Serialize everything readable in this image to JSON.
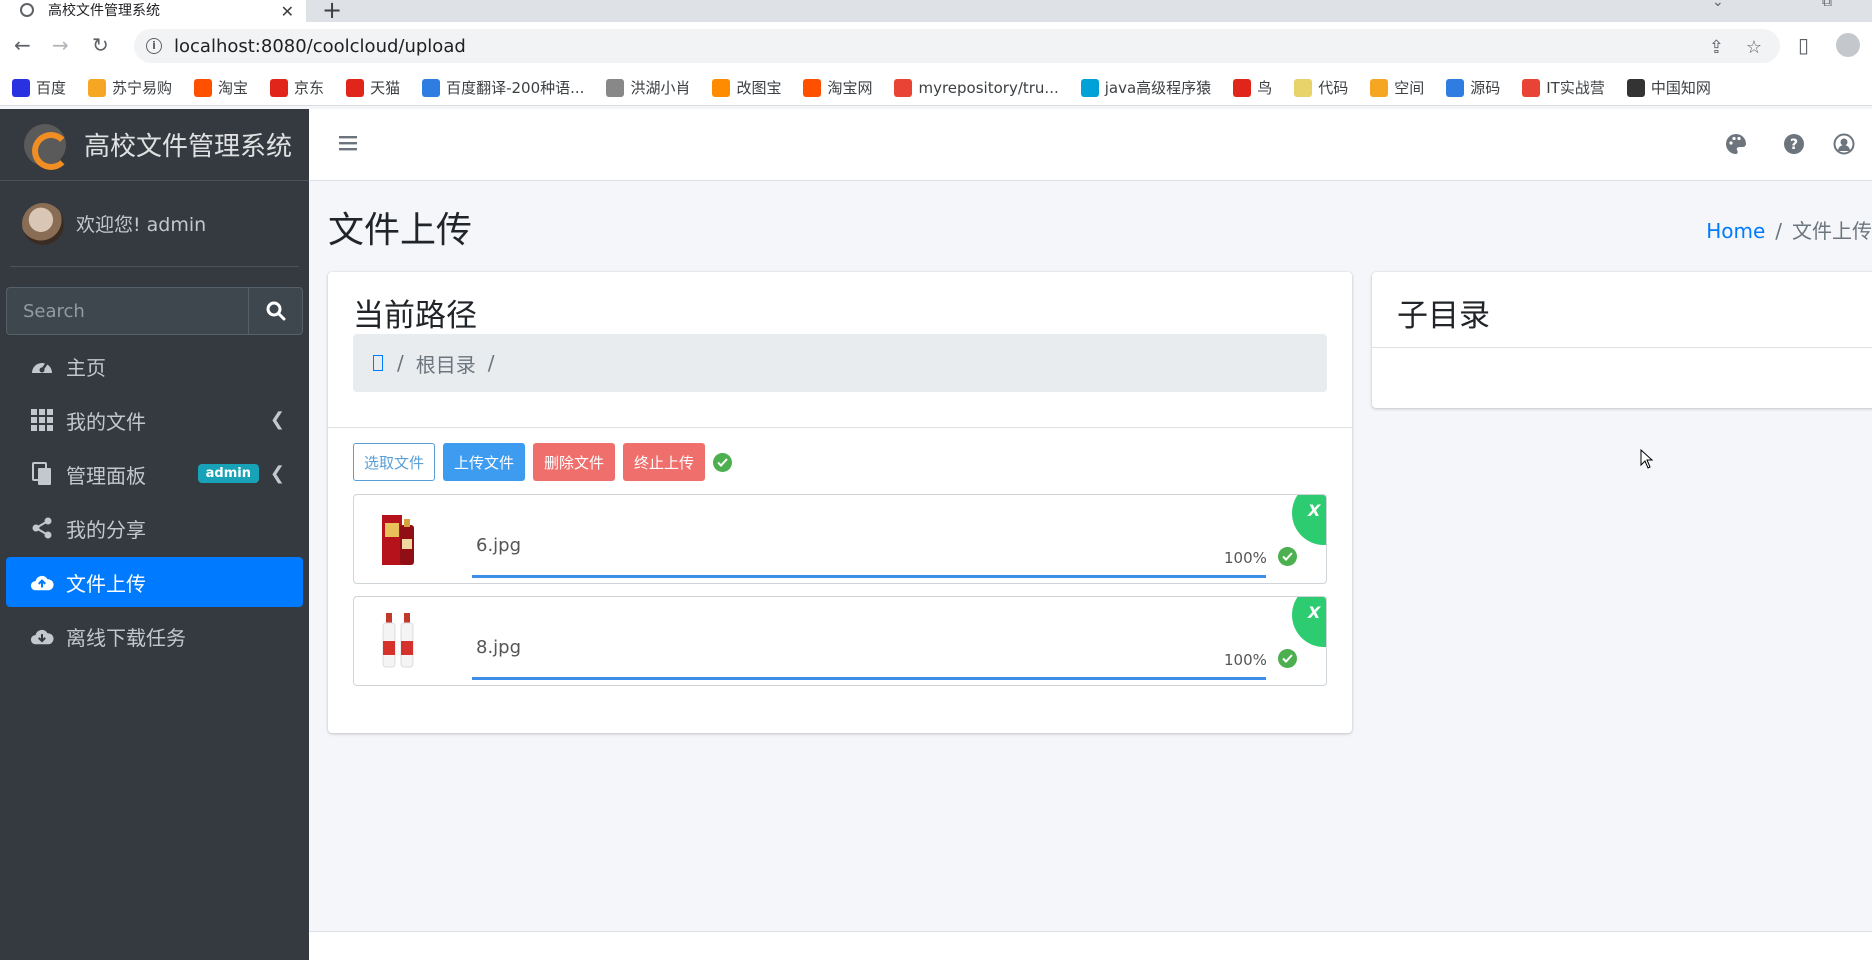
{
  "browser": {
    "tab_title": "高校文件管理系统",
    "url": "localhost:8080/coolcloud/upload",
    "bookmarks": [
      {
        "label": "百度",
        "color": "#2932e1"
      },
      {
        "label": "苏宁易购",
        "color": "#f5a623"
      },
      {
        "label": "淘宝",
        "color": "#ff5000"
      },
      {
        "label": "京东",
        "color": "#e1251b"
      },
      {
        "label": "天猫",
        "color": "#e1251b"
      },
      {
        "label": "百度翻译-200种语...",
        "color": "#2f7de1"
      },
      {
        "label": "洪湖小肖",
        "color": "#888888"
      },
      {
        "label": "改图宝",
        "color": "#ff8c00"
      },
      {
        "label": "淘宝网",
        "color": "#ff5000"
      },
      {
        "label": "myrepository/tru...",
        "color": "#e84335"
      },
      {
        "label": "java高级程序猿",
        "color": "#00a1d6"
      },
      {
        "label": "鸟",
        "color": "#e1251b"
      },
      {
        "label": "代码",
        "color": "#e8d36b"
      },
      {
        "label": "空间",
        "color": "#f5a623"
      },
      {
        "label": "源码",
        "color": "#2f7de1"
      },
      {
        "label": "IT实战营",
        "color": "#e84335"
      },
      {
        "label": "中国知网",
        "color": "#333333"
      }
    ]
  },
  "sidebar": {
    "brand": "高校文件管理系统",
    "user": "欢迎您! admin",
    "search_placeholder": "Search",
    "items": [
      {
        "label": "主页",
        "icon": "dashboard-icon"
      },
      {
        "label": "我的文件",
        "icon": "grid-icon"
      },
      {
        "label": "管理面板",
        "icon": "copy-icon",
        "badge": "admin"
      },
      {
        "label": "我的分享",
        "icon": "share-icon"
      },
      {
        "label": "文件上传",
        "icon": "cloud-upload-icon"
      },
      {
        "label": "离线下载任务",
        "icon": "cloud-download-icon"
      }
    ]
  },
  "header": {
    "page_title": "文件上传",
    "breadcrumb_home": "Home",
    "breadcrumb_current": "文件上传"
  },
  "upload_card": {
    "title": "当前路径",
    "path_root": "根目录",
    "buttons": {
      "select": "选取文件",
      "upload": "上传文件",
      "delete": "删除文件",
      "stop": "终止上传"
    },
    "files": [
      {
        "name": "6.jpg",
        "progress": "100%",
        "progress_value": 100,
        "remove": "X"
      },
      {
        "name": "8.jpg",
        "progress": "100%",
        "progress_value": 100,
        "remove": "X"
      }
    ]
  },
  "subdir_card": {
    "title": "子目录"
  },
  "colors": {
    "sidebar_bg": "#343a40",
    "active": "#007bff",
    "success": "#2ecc71",
    "danger": "#ef6f6c"
  }
}
